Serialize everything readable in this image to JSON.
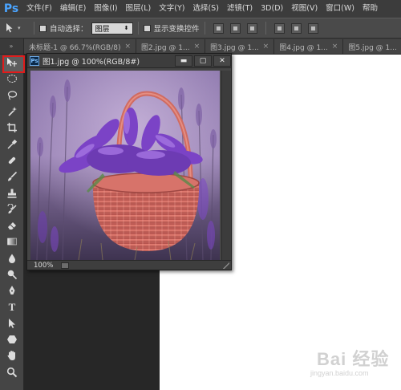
{
  "app": {
    "logo": "Ps"
  },
  "menu": [
    {
      "label": "文件(F)"
    },
    {
      "label": "编辑(E)"
    },
    {
      "label": "图像(I)"
    },
    {
      "label": "图层(L)"
    },
    {
      "label": "文字(Y)"
    },
    {
      "label": "选择(S)"
    },
    {
      "label": "滤镜(T)"
    },
    {
      "label": "3D(D)"
    },
    {
      "label": "视图(V)"
    },
    {
      "label": "窗口(W)"
    },
    {
      "label": "帮助"
    }
  ],
  "options": {
    "auto_select_label": "自动选择：",
    "auto_select_value": "图层",
    "auto_select_checked": false,
    "show_transform_label": "显示变换控件",
    "show_transform_checked": false
  },
  "tabs": [
    {
      "label": "未标题-1 @ 66.7%(RGB/8)"
    },
    {
      "label": "图2.jpg @ 1..."
    },
    {
      "label": "图3.jpg @ 1..."
    },
    {
      "label": "图4.jpg @ 1..."
    },
    {
      "label": "图5.jpg @ 1..."
    }
  ],
  "tools": [
    {
      "icon": "move-tool-icon",
      "active": true
    },
    {
      "icon": "marquee-tool-icon"
    },
    {
      "icon": "lasso-tool-icon"
    },
    {
      "icon": "quick-select-tool-icon"
    },
    {
      "icon": "crop-tool-icon"
    },
    {
      "icon": "eyedropper-tool-icon"
    },
    {
      "icon": "healing-brush-tool-icon"
    },
    {
      "icon": "brush-tool-icon"
    },
    {
      "icon": "clone-stamp-tool-icon"
    },
    {
      "icon": "history-brush-tool-icon"
    },
    {
      "icon": "eraser-tool-icon"
    },
    {
      "icon": "gradient-tool-icon"
    },
    {
      "icon": "blur-tool-icon"
    },
    {
      "icon": "dodge-tool-icon"
    },
    {
      "icon": "pen-tool-icon"
    },
    {
      "icon": "type-tool-icon",
      "glyph": "T"
    },
    {
      "icon": "path-select-tool-icon"
    },
    {
      "icon": "shape-tool-icon"
    },
    {
      "icon": "hand-tool-icon"
    },
    {
      "icon": "zoom-tool-icon"
    }
  ],
  "document": {
    "icon_label": "Ps",
    "title": "图1.jpg @ 100%(RGB/8#)",
    "zoom": "100%",
    "minimize": "▬",
    "maximize": "▢",
    "close": "✕"
  },
  "watermark": {
    "text": "Bai 经验",
    "url": "jingyan.baidu.com"
  },
  "colors": {
    "highlight": "#e21b1b",
    "ps_blue": "#4aa4ff"
  }
}
